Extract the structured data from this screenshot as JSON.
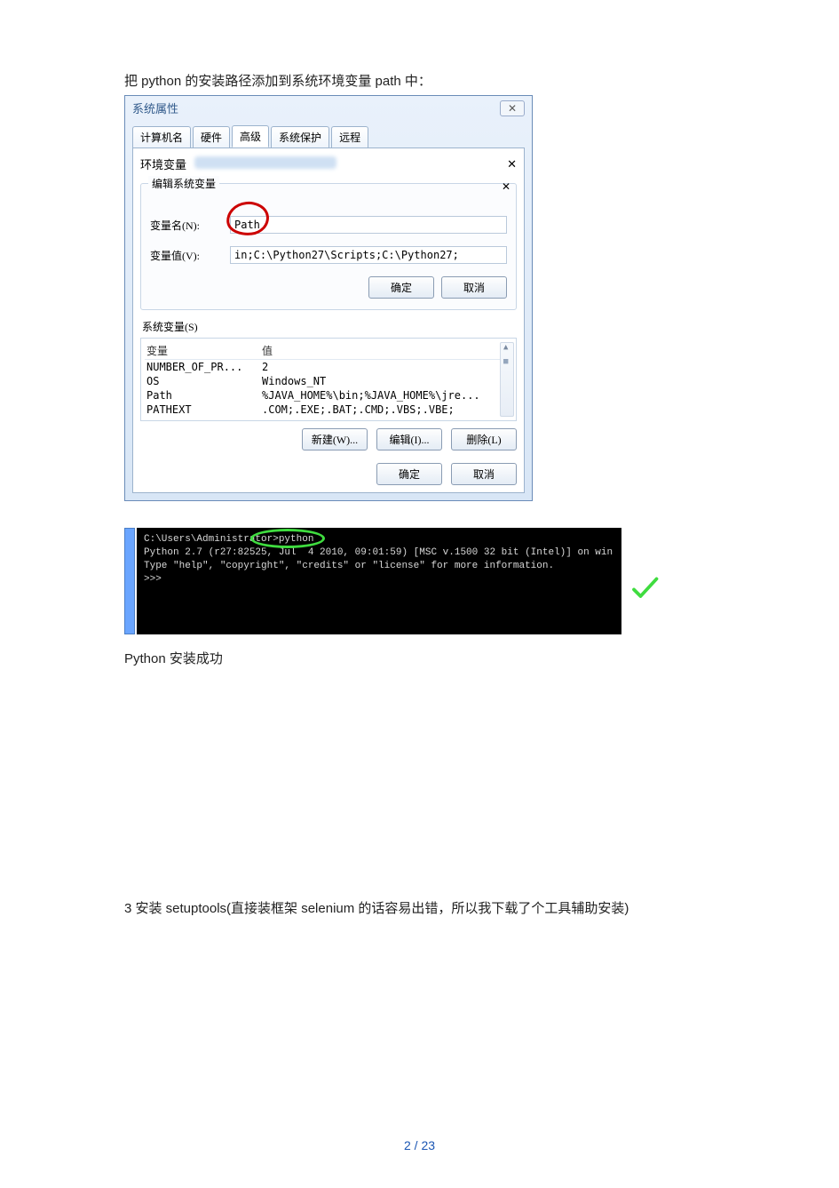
{
  "intro_text": "把 python 的安装路径添加到系统环境变量 path 中：",
  "window": {
    "title": "系统属性",
    "close_glyph": "✕",
    "tabs": [
      "计算机名",
      "硬件",
      "高级",
      "系统保护",
      "远程"
    ],
    "env_section_title": "环境变量",
    "edit_box": {
      "title": "编辑系统变量",
      "name_label": "变量名(N):",
      "name_value": "Path",
      "value_label": "变量值(V):",
      "value_value": "in;C:\\Python27\\Scripts;C:\\Python27;",
      "ok": "确定",
      "cancel": "取消"
    },
    "sysvar_label": "系统变量(S)",
    "sysvar_headers": {
      "var": "变量",
      "val": "值"
    },
    "sysvars": [
      {
        "name": "NUMBER_OF_PR...",
        "value": "2"
      },
      {
        "name": "OS",
        "value": "Windows_NT"
      },
      {
        "name": "Path",
        "value": "%JAVA_HOME%\\bin;%JAVA_HOME%\\jre..."
      },
      {
        "name": "PATHEXT",
        "value": ".COM;.EXE;.BAT;.CMD;.VBS;.VBE;"
      }
    ],
    "env_buttons": {
      "new": "新建(W)...",
      "edit": "编辑(I)...",
      "del": "删除(L)"
    },
    "final_ok": "确定",
    "final_cancel": "取消"
  },
  "cmd": {
    "line1": "C:\\Users\\Administrator>python",
    "line2": "Python 2.7 (r27:82525, Jul  4 2010, 09:01:59) [MSC v.1500 32 bit (Intel)] on win",
    "line3": "Type \"help\", \"copyright\", \"credits\" or \"license\" for more information.",
    "prompt": ">>>"
  },
  "success_text": "Python 安装成功",
  "step3_text": "3 安装 setuptools(直接装框架 selenium 的话容易出错，所以我下载了个工具辅助安装)",
  "page_number": "2 / 23"
}
